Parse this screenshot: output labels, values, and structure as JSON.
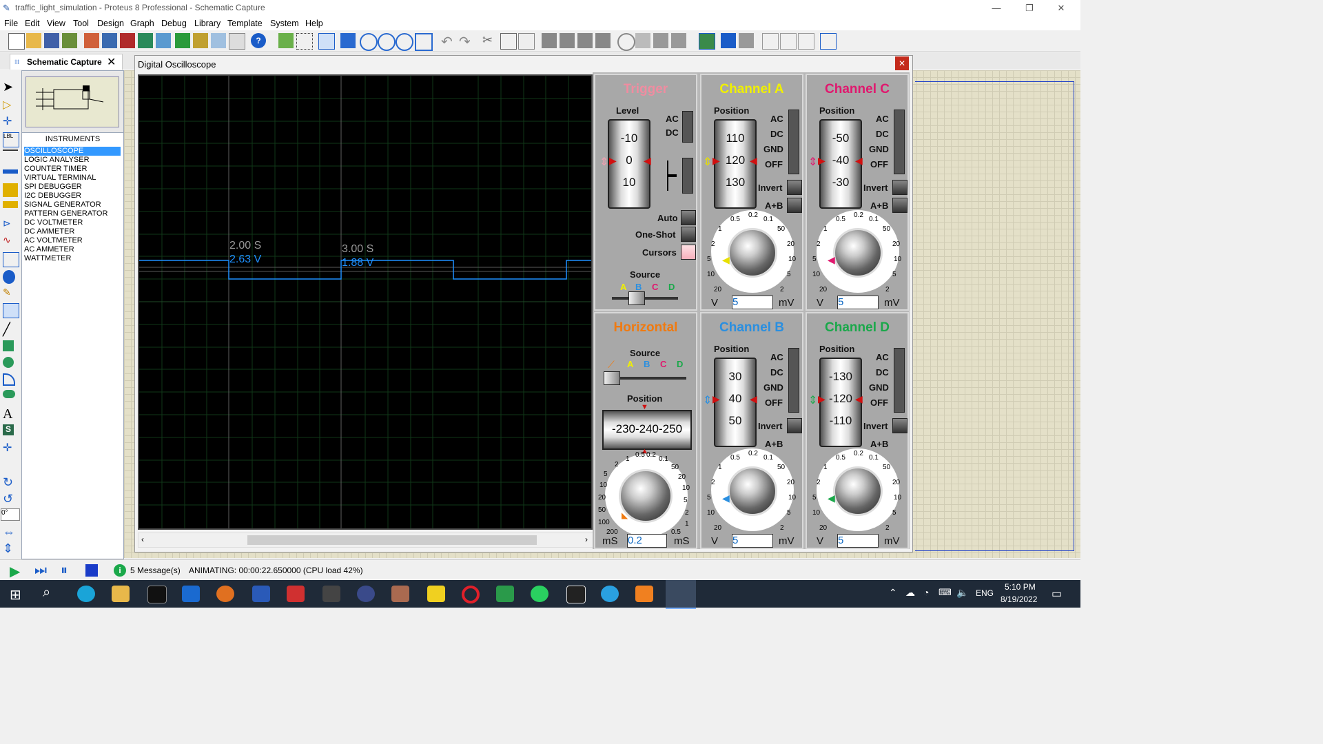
{
  "window": {
    "title": "traffic_light_simulation - Proteus 8 Professional - Schematic Capture"
  },
  "menu": [
    "File",
    "Edit",
    "View",
    "Tool",
    "Design",
    "Graph",
    "Debug",
    "Library",
    "Template",
    "System",
    "Help"
  ],
  "tab": {
    "label": "Schematic Capture"
  },
  "side": {
    "header": "INSTRUMENTS",
    "items": [
      "OSCILLOSCOPE",
      "LOGIC ANALYSER",
      "COUNTER TIMER",
      "VIRTUAL TERMINAL",
      "SPI DEBUGGER",
      "I2C DEBUGGER",
      "SIGNAL GENERATOR",
      "PATTERN GENERATOR",
      "DC VOLTMETER",
      "DC AMMETER",
      "AC VOLTMETER",
      "AC AMMETER",
      "WATTMETER"
    ],
    "selected_index": 0
  },
  "rotation_field": "0°",
  "oscilloscope": {
    "title": "Digital Oscilloscope",
    "cursor1": {
      "time": "2.00 S",
      "volt": "2.63 V"
    },
    "cursor2": {
      "time": "3.00 S",
      "volt": "1.88 V"
    },
    "trigger": {
      "title": "Trigger",
      "level_label": "Level",
      "level_values": [
        "-10",
        "0",
        "10"
      ],
      "ac": "AC",
      "dc": "DC",
      "auto": "Auto",
      "one_shot": "One-Shot",
      "cursors": "Cursors",
      "source_label": "Source",
      "sources": [
        "A",
        "B",
        "C",
        "D"
      ]
    },
    "horizontal": {
      "title": "Horizontal",
      "source_label": "Source",
      "sources": [
        "A",
        "B",
        "C",
        "D"
      ],
      "position_label": "Position",
      "position_values": "-230-240-250",
      "unit_left": "mS",
      "unit_right": "mS",
      "value": "0.2",
      "ticks": [
        "0.5",
        "0.2",
        "0.1",
        "50",
        "20",
        "10",
        "5",
        "2",
        "1",
        "0.5",
        "200",
        "100",
        "50",
        "20",
        "10",
        "5",
        "2",
        "1"
      ]
    },
    "channel_a": {
      "title": "Channel A",
      "position_label": "Position",
      "position_values": [
        "110",
        "120",
        "130"
      ],
      "value": "5",
      "unit_left": "V",
      "unit_right": "mV"
    },
    "channel_b": {
      "title": "Channel B",
      "position_label": "Position",
      "position_values": [
        "30",
        "40",
        "50"
      ],
      "value": "5",
      "unit_left": "V",
      "unit_right": "mV"
    },
    "channel_c": {
      "title": "Channel C",
      "position_label": "Position",
      "position_values": [
        "-50",
        "-40",
        "-30"
      ],
      "value": "5",
      "unit_left": "V",
      "unit_right": "mV"
    },
    "channel_d": {
      "title": "Channel D",
      "position_label": "Position",
      "position_values": [
        "-130",
        "-120",
        "-110"
      ],
      "value": "5",
      "unit_left": "V",
      "unit_right": "mV"
    },
    "coupling": [
      "AC",
      "DC",
      "GND",
      "OFF"
    ],
    "invert": "Invert",
    "aplusb": "A+B",
    "knob_ticks": [
      "0.5",
      "0.2",
      "0.1",
      "50",
      "20",
      "10",
      "5",
      "2",
      "1",
      "2",
      "5",
      "10",
      "20"
    ]
  },
  "status": {
    "messages": "5 Message(s)",
    "animating": "ANIMATING: 00:00:22.650000 (CPU load 42%)"
  },
  "tray": {
    "lang": "ENG",
    "time": "5:10 PM",
    "date": "8/19/2022"
  },
  "colors": {
    "trigger": "#f08ca0",
    "channel_a": "#f0f000",
    "channel_b": "#2a8fe0",
    "channel_c": "#e0186e",
    "channel_d": "#1aa84a",
    "horizontal": "#f07a10",
    "trace": "#1e90ff",
    "selection": "#3399ff"
  }
}
